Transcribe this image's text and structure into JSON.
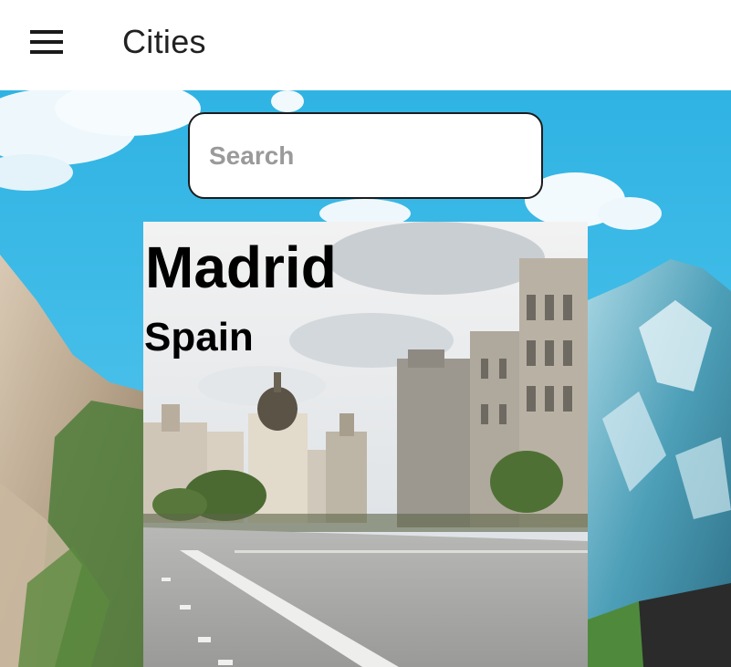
{
  "app_bar": {
    "title": "Cities",
    "menu_icon": "hamburger-menu-icon"
  },
  "search": {
    "placeholder": "Search",
    "value": ""
  },
  "cities": [
    {
      "city": "Madrid",
      "country": "Spain"
    }
  ],
  "colors": {
    "app_bar_background": "#ffffff",
    "title_text": "#212121",
    "sky": "#35b9e6",
    "search_border": "#1c1c1c",
    "placeholder_text": "#9a9a9a",
    "card_text": "#000000"
  }
}
